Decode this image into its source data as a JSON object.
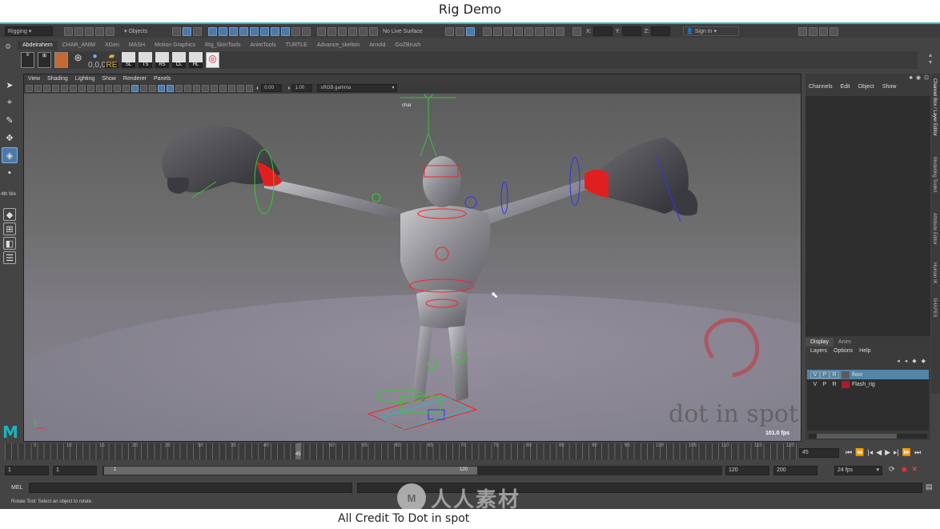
{
  "video_title": "Rig Demo",
  "credit": "All Credit To  Dot in spot",
  "statusline": {
    "mode": "Rigging",
    "objects": "Objects",
    "live_surface": "No Live Surface",
    "x_label": "X:",
    "y_label": "Y:",
    "z_label": "Z:",
    "sign_in": "Sign In"
  },
  "shelf": {
    "tabs": [
      "Abdelrahem",
      "CHAR_ANIM",
      "XGen",
      "MASH",
      "Motion Graphics",
      "Rig_SkinTools",
      "AnimTools",
      "TURTLE",
      "Advance_skelton",
      "Arnold",
      "GoZBrush"
    ],
    "active_tab": "Abdelrahem",
    "icons": [
      {
        "name": "abc-icon",
        "label": ""
      },
      {
        "name": "grid-icon",
        "label": ""
      },
      {
        "name": "image-icon",
        "label": ""
      },
      {
        "name": "target-icon",
        "label": ""
      },
      {
        "name": "globe-icon",
        "label": "0,0,0"
      },
      {
        "name": "folder-re-icon",
        "label": "RE"
      },
      {
        "name": "sl-icon",
        "label": "SL"
      },
      {
        "name": "ts-icon",
        "label": "TS"
      },
      {
        "name": "rs-icon",
        "label": "RS"
      },
      {
        "name": "cl-icon",
        "label": "CL"
      },
      {
        "name": "hl-icon",
        "label": "HL"
      }
    ]
  },
  "viewport": {
    "menus": [
      "View",
      "Shading",
      "Lighting",
      "Show",
      "Renderer",
      "Panels"
    ],
    "field_1": "0.00",
    "field_2": "1.00",
    "color_space": "sRGB gamma",
    "fps_hud": "101.0 fps",
    "camera_label": "char",
    "watermark_text": "dot in spot"
  },
  "left_toolbox": {
    "truncated_label": "4th We"
  },
  "channel_box": {
    "menus": [
      "Channels",
      "Edit",
      "Object",
      "Show"
    ],
    "side_tabs": [
      "Channel Box / Layer Editor",
      "Modelling Toolkit",
      "Attribute Editor",
      "Human IK",
      "SHAPES"
    ]
  },
  "layer_editor": {
    "tabs": [
      "Display",
      "Anim"
    ],
    "active_tab": "Display",
    "menus": [
      "Layers",
      "Options",
      "Help"
    ],
    "layers": [
      {
        "v": "V",
        "p": "P",
        "r": "R",
        "name": "floor",
        "color": "#5b5b5b",
        "selected": true
      },
      {
        "v": "V",
        "p": "P",
        "r": "R",
        "name": "Flash_rig",
        "color": "#b0182b",
        "selected": false
      }
    ]
  },
  "timeline": {
    "ticks": [
      "5",
      "10",
      "15",
      "20",
      "25",
      "30",
      "35",
      "40",
      "45",
      "50",
      "55",
      "60",
      "65",
      "70",
      "75",
      "80",
      "85",
      "90",
      "95",
      "100",
      "105",
      "110",
      "115",
      "120"
    ],
    "current_frame_marker": "45",
    "current_frame": "45"
  },
  "range": {
    "start": "1",
    "start2": "1",
    "slider_start": "1",
    "slider_end": "120",
    "end": "120",
    "end2": "200",
    "fps": "24 fps"
  },
  "command_line": {
    "label": "MEL"
  },
  "help_line": "Rotate Tool: Select an object to rotate.",
  "logo_watermark": "人人素材",
  "colors": {
    "teal_accent": "#36b7c6",
    "maya_logo": "#19b3c1",
    "selection_blue": "#4b7aa8",
    "rig_red": "#ff2020"
  }
}
